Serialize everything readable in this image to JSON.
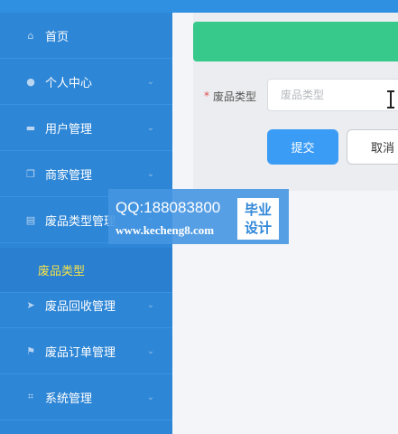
{
  "sidebar": {
    "items": [
      {
        "label": "首页",
        "icon": "home-icon",
        "glyph": "⌂",
        "has_children": false
      },
      {
        "label": "个人中心",
        "icon": "user-icon",
        "glyph": "●",
        "has_children": true
      },
      {
        "label": "用户管理",
        "icon": "chat-icon",
        "glyph": "▬",
        "has_children": true
      },
      {
        "label": "商家管理",
        "icon": "copy-icon",
        "glyph": "❐",
        "has_children": true
      },
      {
        "label": "废品类型管理",
        "icon": "clipboard-icon",
        "glyph": "▤",
        "has_children": true
      },
      {
        "label": "废品回收管理",
        "icon": "send-icon",
        "glyph": "➤",
        "has_children": true
      },
      {
        "label": "废品订单管理",
        "icon": "flag-icon",
        "glyph": "⚑",
        "has_children": true
      },
      {
        "label": "系统管理",
        "icon": "crop-icon",
        "glyph": "⌗",
        "has_children": true
      }
    ],
    "active_sub_item": "废品类型",
    "chevron": "⌄"
  },
  "form": {
    "field_label": "废品类型",
    "required_mark": "*",
    "field_placeholder": "废品类型",
    "field_value": "",
    "submit_label": "提交",
    "cancel_label": "取消"
  },
  "watermark": {
    "line1": "QQ:188083800",
    "line2": "www.kecheng8.com",
    "badge_top": "毕业",
    "badge_bottom": "设计"
  },
  "colors": {
    "sidebar_bg": "#2e86d6",
    "active_sub_text": "#f5e34a",
    "banner": "#37c98b",
    "primary_button": "#3b9cf6"
  }
}
